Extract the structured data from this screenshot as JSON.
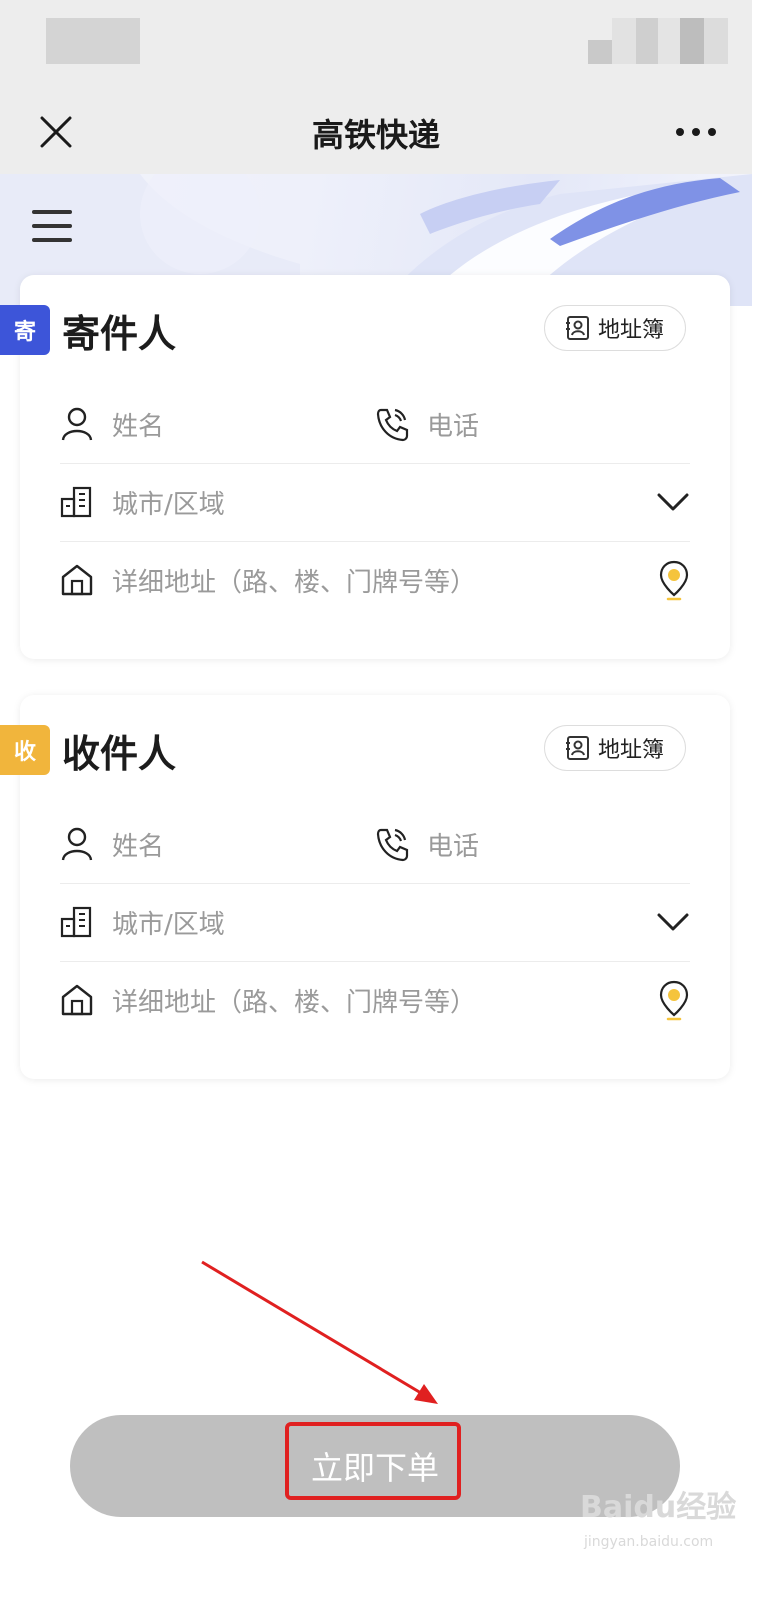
{
  "nav": {
    "title": "高铁快递"
  },
  "sender": {
    "tag": "寄",
    "title": "寄件人",
    "address_book": "地址簿",
    "name_placeholder": "姓名",
    "phone_placeholder": "电话",
    "city_placeholder": "城市/区域",
    "address_placeholder": "详细地址（路、楼、门牌号等）"
  },
  "receiver": {
    "tag": "收",
    "title": "收件人",
    "address_book": "地址簿",
    "name_placeholder": "姓名",
    "phone_placeholder": "电话",
    "city_placeholder": "城市/区域",
    "address_placeholder": "详细地址（路、楼、门牌号等）"
  },
  "submit": {
    "label": "立即下单"
  },
  "watermark": {
    "brand": "Baidu经验",
    "url": "jingyan.baidu.com"
  },
  "colors": {
    "sender_tag": "#3d55d9",
    "receiver_tag": "#f1b53c",
    "submit_bg": "#bfbfbf",
    "highlight": "#e02020"
  },
  "icons": [
    "close-icon",
    "more-icon",
    "menu-icon",
    "contact-book-icon",
    "person-icon",
    "phone-icon",
    "building-icon",
    "chevron-down-icon",
    "home-icon",
    "location-pin-icon"
  ]
}
